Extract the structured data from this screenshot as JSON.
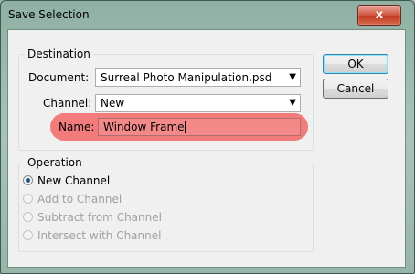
{
  "window": {
    "title": "Save Selection",
    "close_label": "x"
  },
  "destination": {
    "legend": "Destination",
    "document_label": "Document:",
    "document_value": "Surreal Photo Manipulation.psd",
    "channel_label": "Channel:",
    "channel_value": "New",
    "name_label": "Name:",
    "name_value": "Window Frame"
  },
  "operation": {
    "legend": "Operation",
    "options": [
      {
        "label": "New Channel",
        "checked": true,
        "enabled": true
      },
      {
        "label": "Add to Channel",
        "checked": false,
        "enabled": false
      },
      {
        "label": "Subtract from Channel",
        "checked": false,
        "enabled": false
      },
      {
        "label": "Intersect with Channel",
        "checked": false,
        "enabled": false
      }
    ]
  },
  "buttons": {
    "ok_label": "OK",
    "cancel_label": "Cancel"
  },
  "colors": {
    "highlight": "#f27b7c"
  }
}
